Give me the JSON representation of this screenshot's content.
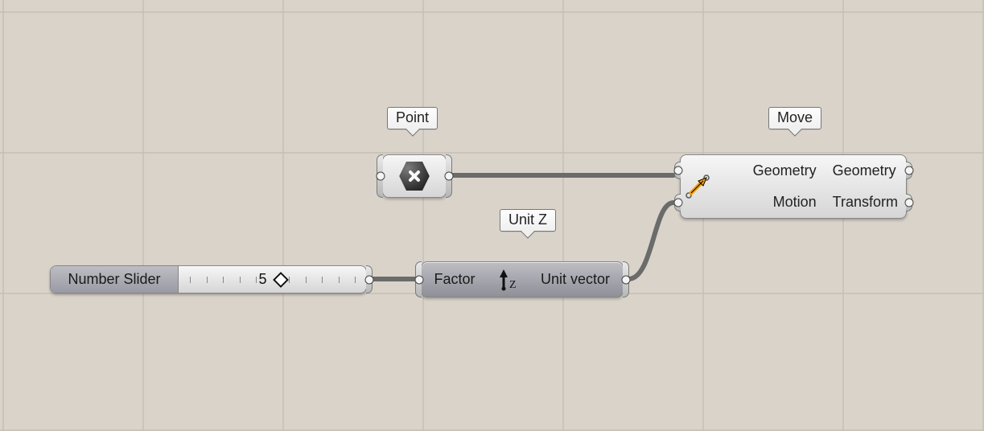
{
  "nodes": {
    "point": {
      "tooltip": "Point"
    },
    "slider": {
      "label": "Number Slider",
      "value": "5"
    },
    "unitz": {
      "tooltip": "Unit Z",
      "input": "Factor",
      "output": "Unit vector"
    },
    "move": {
      "tooltip": "Move",
      "inputs": [
        "Geometry",
        "Motion"
      ],
      "outputs": [
        "Geometry",
        "Transform"
      ]
    }
  },
  "wires": [
    {
      "from": "point.out",
      "to": "move.geometry"
    },
    {
      "from": "slider.out",
      "to": "unitz.factor"
    },
    {
      "from": "unitz.vector",
      "to": "move.motion"
    }
  ]
}
